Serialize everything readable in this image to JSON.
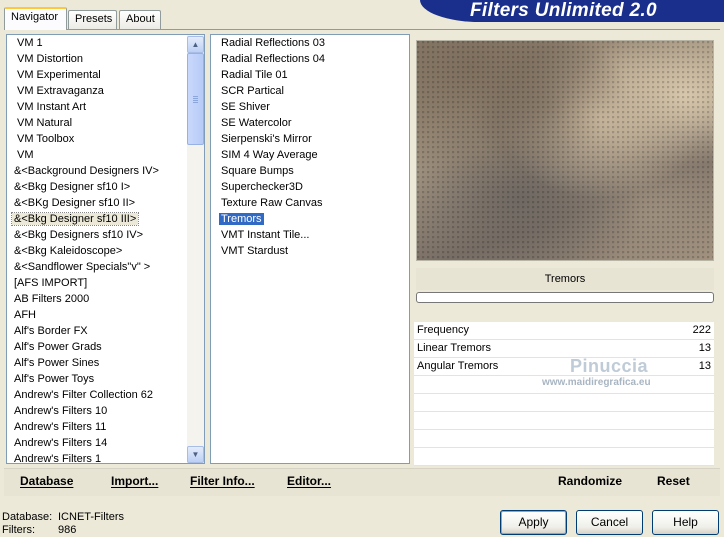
{
  "app_title": "Filters Unlimited 2.0",
  "tabs": [
    "Navigator",
    "Presets",
    "About"
  ],
  "categories": [
    "VM 1",
    "VM Distortion",
    "VM Experimental",
    "VM Extravaganza",
    "VM Instant Art",
    "VM Natural",
    "VM Toolbox",
    "VM",
    "&<Background Designers IV>",
    "&<Bkg Designer sf10 I>",
    "&<BKg Designer sf10 II>",
    "&<Bkg Designer sf10 III>",
    "&<Bkg Designers sf10 IV>",
    "&<Bkg Kaleidoscope>",
    "&<Sandflower Specials\"v\" >",
    "[AFS IMPORT]",
    "AB Filters 2000",
    "AFH",
    "Alf's Border FX",
    "Alf's Power Grads",
    "Alf's Power Sines",
    "Alf's Power Toys",
    "Andrew's Filter Collection 62",
    "Andrew's Filters 10",
    "Andrew's Filters 11",
    "Andrew's Filters 14",
    "Andrew's Filters 1"
  ],
  "selected_category": "&<Bkg Designer sf10 III>",
  "filters": [
    "Radial Reflections 03",
    "Radial Reflections 04",
    "Radial Tile 01",
    "SCR  Partical",
    "SE Shiver",
    "SE Watercolor",
    "Sierpenski's Mirror",
    "SIM 4 Way Average",
    "Square Bumps",
    "Superchecker3D",
    "Texture Raw Canvas",
    "Tremors",
    "VMT Instant Tile...",
    "VMT Stardust"
  ],
  "selected_filter": "Tremors",
  "preview_filter_name": "Tremors",
  "parameters": [
    {
      "label": "Frequency",
      "value": "222"
    },
    {
      "label": "Linear Tremors",
      "value": "13"
    },
    {
      "label": "Angular Tremors",
      "value": "13"
    }
  ],
  "watermark": {
    "name": "Pinuccia",
    "url": "www.maidiregrafica.eu"
  },
  "commands": {
    "database": "Database",
    "import": "Import...",
    "filter_info": "Filter Info...",
    "editor": "Editor...",
    "randomize": "Randomize",
    "reset": "Reset"
  },
  "status": {
    "database_label": "Database:",
    "database_value": "ICNET-Filters",
    "filters_label": "Filters:",
    "filters_value": "986"
  },
  "buttons": {
    "apply": "Apply",
    "cancel": "Cancel",
    "help": "Help"
  },
  "colors": {
    "selection": "#316ac5",
    "title_bar": "#1a2e8c",
    "tab_highlight": "#ffc83c"
  },
  "icons": {
    "scroll_up": "arrow-up",
    "scroll_down": "arrow-down"
  }
}
